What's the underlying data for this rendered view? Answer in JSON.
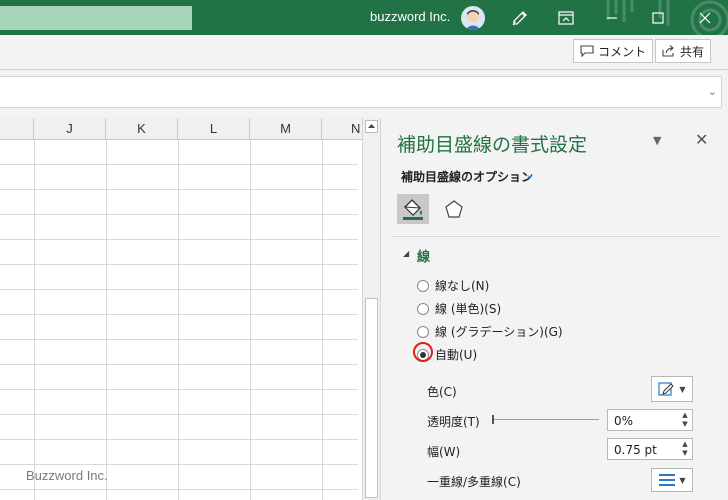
{
  "titlebar": {
    "user_name": "buzzword Inc.",
    "accent_color": "#217346",
    "icons": [
      "avatar",
      "pen-icon",
      "restore-ribbon-icon",
      "minimize-icon",
      "maximize-icon",
      "close-icon"
    ]
  },
  "ribbon": {
    "comment_label": "コメント",
    "share_label": "共有"
  },
  "grid": {
    "columns": [
      "J",
      "K",
      "L",
      "M",
      "N"
    ]
  },
  "watermark": "Buzzword Inc.",
  "pane": {
    "title": "補助目盛線の書式設定",
    "subtitle": "補助目盛線のオプション",
    "tabs": [
      "fill-line-icon",
      "effects-pentagon-icon"
    ],
    "section_title": "線",
    "radio_options": [
      {
        "label": "線なし(N)",
        "checked": false
      },
      {
        "label": "線 (単色)(S)",
        "checked": false
      },
      {
        "label": "線 (グラデーション)(G)",
        "checked": false
      },
      {
        "label": "自動(U)",
        "checked": true
      }
    ],
    "color_label": "色(C)",
    "transparency_label": "透明度(T)",
    "transparency_value": "0%",
    "width_label": "幅(W)",
    "width_value": "0.75 pt",
    "compound_label": "一重線/多重線(C)"
  }
}
